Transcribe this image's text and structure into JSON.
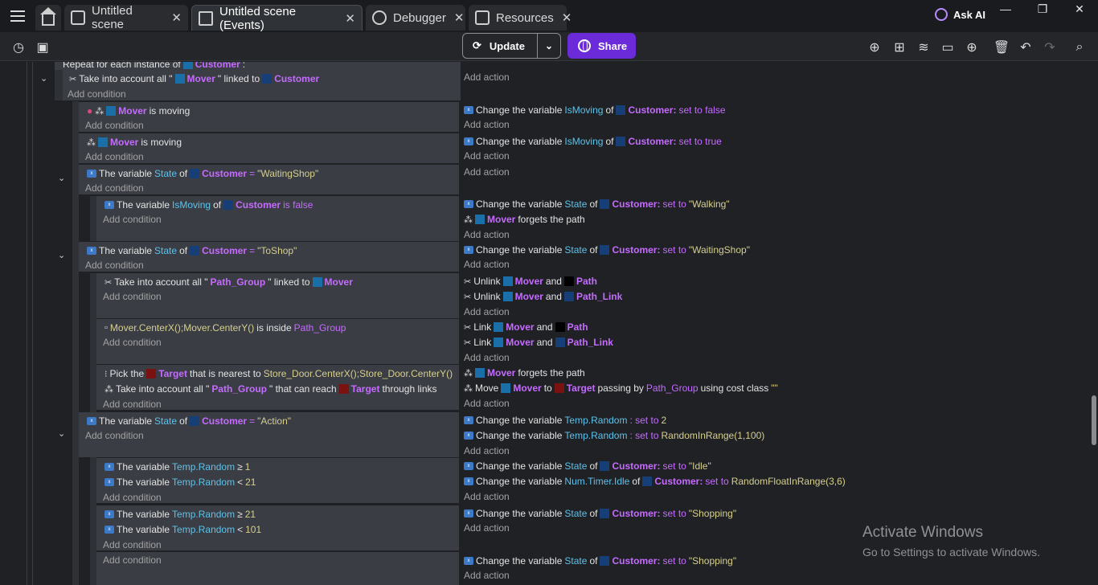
{
  "tabs": [
    {
      "label": "Untitled scene"
    },
    {
      "label": "Untitled scene (Events)"
    },
    {
      "label": "Debugger"
    },
    {
      "label": "Resources"
    }
  ],
  "askai": "Ask AI",
  "toolbar": {
    "update": "Update",
    "share": "Share"
  },
  "events": {
    "repeat": [
      "Repeat for each instance of",
      "Customer",
      ":"
    ],
    "r1": {
      "c": [
        "Take into account all \"",
        "Mover",
        "\" linked to",
        "Customer"
      ]
    },
    "r2": {
      "c": [
        "Mover",
        "is moving"
      ],
      "a": [
        "Change the variable",
        "IsMoving",
        "of",
        "Customer:",
        "set to false"
      ]
    },
    "r3": {
      "c": [
        "Mover",
        "is moving"
      ],
      "a": [
        "Change the variable",
        "IsMoving",
        "of",
        "Customer:",
        "set to true"
      ]
    },
    "r4": {
      "c": [
        "The variable",
        "State",
        "of",
        "Customer",
        "=",
        "\"WaitingShop\""
      ]
    },
    "r5": {
      "c": [
        "The variable",
        "IsMoving",
        "of",
        "Customer",
        "is false"
      ],
      "a1": [
        "Change the variable",
        "State",
        "of",
        "Customer:",
        "set to",
        "\"Walking\""
      ],
      "a2": [
        "Mover",
        "forgets the path"
      ]
    },
    "r6": {
      "c": [
        "The variable",
        "State",
        "of",
        "Customer",
        "=",
        "\"ToShop\""
      ],
      "a": [
        "Change the variable",
        "State",
        "of",
        "Customer:",
        "set to",
        "\"WaitingShop\""
      ]
    },
    "r7": {
      "c": [
        "Take into account all \"",
        "Path_Group",
        "\" linked to",
        "Mover"
      ],
      "a1": [
        "Unlink",
        "Mover",
        "and",
        "Path"
      ],
      "a2": [
        "Unlink",
        "Mover",
        "and",
        "Path_Link"
      ]
    },
    "r8": {
      "c": [
        "Mover.CenterX();Mover.CenterY()",
        "is inside",
        "Path_Group"
      ],
      "a1": [
        "Link",
        "Mover",
        "and",
        "Path"
      ],
      "a2": [
        "Link",
        "Mover",
        "and",
        "Path_Link"
      ]
    },
    "r9": {
      "c1": [
        "Pick the",
        "Target",
        "that is nearest to",
        "Store_Door.CenterX();Store_Door.CenterY()"
      ],
      "c2": [
        "Take into account all \"",
        "Path_Group",
        "\" that can reach",
        "Target",
        "through links"
      ],
      "a1": [
        "Mover",
        "forgets the path"
      ],
      "a2": [
        "Move",
        "Mover",
        "to",
        "Target",
        "passing by",
        "Path_Group",
        "using cost class",
        "\"\""
      ]
    },
    "r10": {
      "c": [
        "The variable",
        "State",
        "of",
        "Customer",
        "=",
        "\"Action\""
      ],
      "a1": [
        "Change the variable",
        "Temp.Random",
        ": set to",
        "2"
      ],
      "a2": [
        "Change the variable",
        "Temp.Random",
        ": set to",
        "RandomInRange(1,100)"
      ]
    },
    "r11": {
      "c1": [
        "The variable",
        "Temp.Random",
        "≥",
        "1"
      ],
      "c2": [
        "The variable",
        "Temp.Random",
        "<",
        "21"
      ],
      "a1": [
        "Change the variable",
        "State",
        "of",
        "Customer:",
        "set to",
        "\"Idle\""
      ],
      "a2": [
        "Change the variable",
        "Num.Timer.Idle",
        "of",
        "Customer:",
        "set to",
        "RandomFloatInRange(3,6)"
      ]
    },
    "r12": {
      "c1": [
        "The variable",
        "Temp.Random",
        "≥",
        "21"
      ],
      "c2": [
        "The variable",
        "Temp.Random",
        "<",
        "101"
      ],
      "a": [
        "Change the variable",
        "State",
        "of",
        "Customer:",
        "set to",
        "\"Shopping\""
      ]
    },
    "r13": {
      "a": [
        "Change the variable",
        "State",
        "of",
        "Customer:",
        "set to",
        "\"Shopping\""
      ]
    },
    "add_condition": "Add condition",
    "add_action": "Add action"
  },
  "watermark": {
    "title": "Activate Windows",
    "subtitle": "Go to Settings to activate Windows."
  }
}
